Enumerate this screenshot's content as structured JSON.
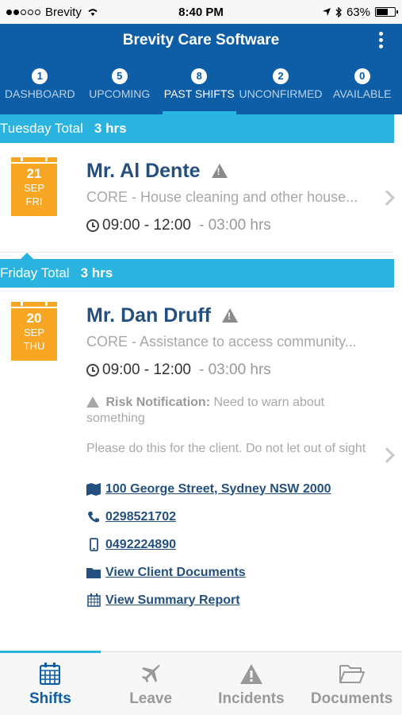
{
  "status_bar": {
    "carrier": "Brevity",
    "time": "8:40 PM",
    "battery": "63%",
    "battery_level": 0.63
  },
  "header": {
    "title": "Brevity Care Software"
  },
  "tabs": [
    {
      "count": "1",
      "label": "DASHBOARD"
    },
    {
      "count": "5",
      "label": "UPCOMING"
    },
    {
      "count": "8",
      "label": "PAST SHIFTS"
    },
    {
      "count": "2",
      "label": "UNCONFIRMED"
    },
    {
      "count": "0",
      "label": "AVAILABLE"
    }
  ],
  "active_tab": "PAST SHIFTS",
  "days": [
    {
      "label": "Tuesday Total",
      "total": "3 hrs",
      "shift": {
        "day": "21",
        "month": "SEP",
        "weekday": "FRI",
        "client": "Mr. Al Dente",
        "service": "CORE - House cleaning and other house...",
        "time": "09:00 - 12:00",
        "duration": "- 03:00 hrs"
      }
    },
    {
      "label": "Friday Total",
      "total": "3 hrs",
      "shift": {
        "day": "20",
        "month": "SEP",
        "weekday": "THU",
        "client": "Mr. Dan Druff",
        "service": "CORE - Assistance to access community...",
        "time": "09:00 - 12:00",
        "duration": "- 03:00 hrs",
        "risk_label": "Risk Notification:",
        "risk_text": "Need to warn about something",
        "note": "Please do this for the client. Do not let out of sight",
        "address": "100 George Street, Sydney NSW 2000",
        "phone": "0298521702",
        "mobile": "0492224890",
        "documents_link": "View Client Documents",
        "report_link": "View Summary Report"
      }
    }
  ],
  "bottom_nav": [
    {
      "label": "Shifts",
      "icon": "calendar-icon"
    },
    {
      "label": "Leave",
      "icon": "plane-icon"
    },
    {
      "label": "Incidents",
      "icon": "warning-icon"
    },
    {
      "label": "Documents",
      "icon": "folder-icon"
    }
  ],
  "colors": {
    "header": "#0d5ea6",
    "accent": "#2bb3df",
    "calendar": "#f6a623",
    "link": "#24507f"
  }
}
